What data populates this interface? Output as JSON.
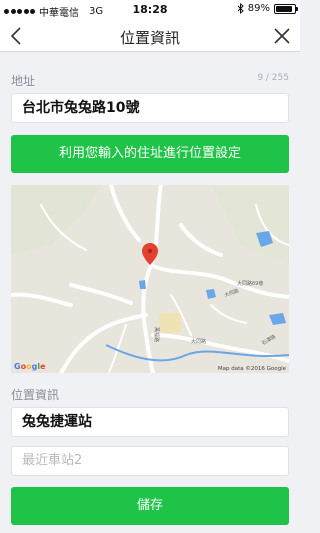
{
  "status_bar": {
    "carrier": "中華電信",
    "network": "3G",
    "time": "18:28",
    "battery": "89%",
    "battery_level": 0.89
  },
  "nav": {
    "title": "位置資訊",
    "back_icon": "chevron-left-icon",
    "close_icon": "close-icon"
  },
  "address": {
    "label": "地址",
    "counter": "9 / 255",
    "value": "台北市兔兔路10號"
  },
  "set_location_button": "利用您輸入的住址進行位置設定",
  "map": {
    "credit": "Map data ©2016 Google",
    "logo": [
      "G",
      "o",
      "o",
      "g",
      "l",
      "e"
    ],
    "road_labels": [
      "大同路",
      "大同路",
      "石潭路",
      "大同路69巷",
      "萬福路"
    ]
  },
  "location_info": {
    "label": "位置資訊",
    "station_value": "兔兔捷運站",
    "nearest_station_placeholder": "最近車站2"
  },
  "save_button": "儲存",
  "colors": {
    "accent_green": "#1fc348",
    "background": "#eff1f4",
    "pin_red": "#e3402f"
  }
}
